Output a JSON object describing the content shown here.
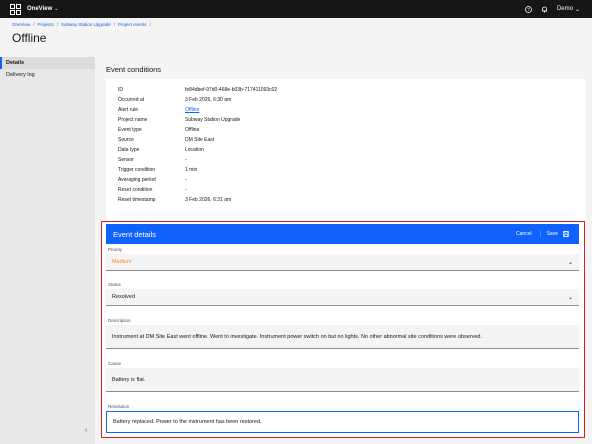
{
  "topbar": {
    "app_name": "OneView",
    "user": "Demo"
  },
  "breadcrumb": [
    "OneView",
    "Projects",
    "Subway Station Upgrade",
    "Project events"
  ],
  "page_title": "Offline",
  "sidebar": {
    "items": [
      {
        "label": "Details"
      },
      {
        "label": "Delivery log"
      }
    ]
  },
  "conditions": {
    "title": "Event conditions",
    "rows": [
      {
        "key": "ID",
        "value": "fe84dbef-97d0-468e-b03b-717411093c02"
      },
      {
        "key": "Occurred at",
        "value": "3 Feb 2026, 6:30 am"
      },
      {
        "key": "Alert rule",
        "value": "Offline"
      },
      {
        "key": "Project name",
        "value": "Subway Station Upgrade"
      },
      {
        "key": "Event type",
        "value": "Offline"
      },
      {
        "key": "Source",
        "value": "DM Site East"
      },
      {
        "key": "Data type",
        "value": "Location"
      },
      {
        "key": "Sensor",
        "value": "-"
      },
      {
        "key": "Trigger condition",
        "value": "1 min"
      },
      {
        "key": "Averaging period",
        "value": "-"
      },
      {
        "key": "Reset condition",
        "value": "-"
      },
      {
        "key": "Reset timestamp",
        "value": "3 Feb 2026, 6:31 am"
      }
    ]
  },
  "details": {
    "title": "Event details",
    "cancel_label": "Cancel",
    "save_label": "Save",
    "priority": {
      "label": "Priority",
      "value": "Medium"
    },
    "status": {
      "label": "Status",
      "value": "Resolved"
    },
    "description": {
      "label": "Description",
      "value": "Instrument at DM Site East went offline. Went to investigate. Instrument power switch on but no lights. No other abnormal site conditions were observed."
    },
    "cause": {
      "label": "Cause",
      "value": "Battery is flat."
    },
    "resolution": {
      "label": "Resolution",
      "value": "Battery replaced. Power to the instrument has been restored."
    }
  },
  "colors": {
    "accent": "#0f62fe",
    "topbar": "#161616",
    "priority": "#ff832b",
    "highlight": "#da1e28"
  },
  "icons": [
    "app-logo-icon",
    "help-icon",
    "bell-icon",
    "chevron-down-icon",
    "save-icon",
    "chevron-left-icon"
  ]
}
